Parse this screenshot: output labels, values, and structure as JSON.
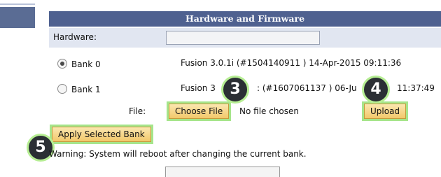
{
  "panel": {
    "title": "Hardware and Firmware"
  },
  "hardware": {
    "label": "Hardware:",
    "value": ""
  },
  "banks": [
    {
      "label": "Bank 0",
      "firmware": "Fusion 3.0.1i (#1504140911 )  14-Apr-2015  09:11:36",
      "selected": true
    },
    {
      "label": "Bank 1",
      "firmware_left": "Fusion 3",
      "firmware_mid": ": (#1607061137 )  06-Ju",
      "firmware_right": "11:37:49",
      "selected": false
    }
  ],
  "file": {
    "label": "File:",
    "choose_label": "Choose File",
    "status": "No file chosen"
  },
  "buttons": {
    "upload": "Upload",
    "apply": "Apply Selected Bank"
  },
  "badges": {
    "three": "3",
    "four": "4",
    "five": "5"
  },
  "warning": "Warning: System will reboot after changing the current bank.",
  "colors": {
    "header_bg": "#4f6190",
    "row_bg": "#e1e6f1",
    "highlight": "#a6e58b",
    "button": "#f2c86a"
  }
}
